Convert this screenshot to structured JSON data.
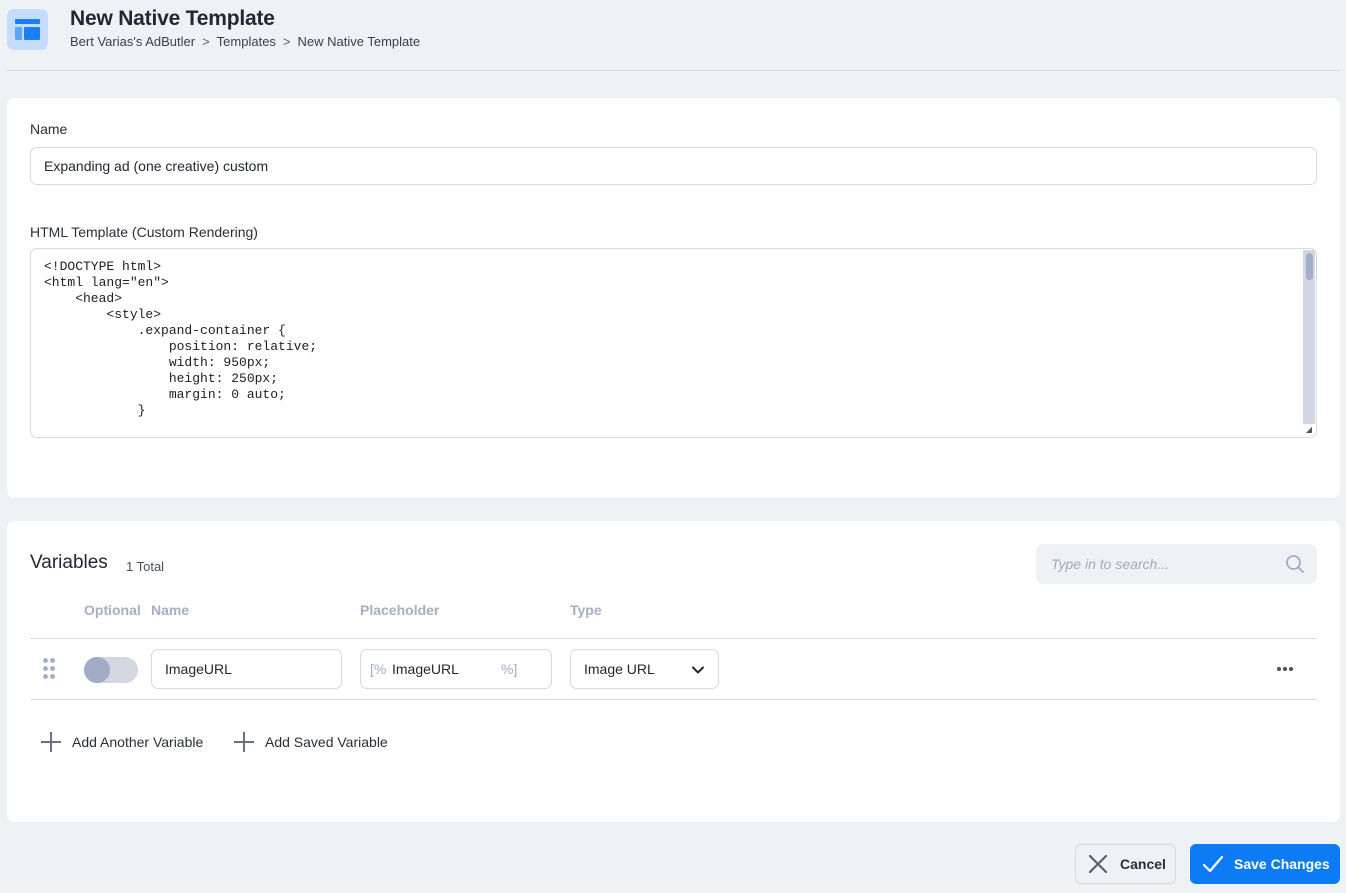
{
  "header": {
    "icon": "template-layout-icon",
    "title": "New Native Template",
    "breadcrumb": [
      "Bert Varias's AdButler",
      "Templates",
      "New Native Template"
    ],
    "breadcrumb_separator": ">"
  },
  "form": {
    "name_label": "Name",
    "name_value": "Expanding ad (one creative) custom",
    "html_label": "HTML Template (Custom Rendering)",
    "html_value": "<!DOCTYPE html>\n<html lang=\"en\">\n    <head>\n        <style>\n            .expand-container {\n                position: relative;\n                width: 950px;\n                height: 250px;\n                margin: 0 auto;\n            }\n"
  },
  "variables": {
    "title": "Variables",
    "count_label": "1 Total",
    "search_placeholder": "Type in to search...",
    "columns": {
      "optional": "Optional",
      "name": "Name",
      "placeholder": "Placeholder",
      "type": "Type"
    },
    "rows": [
      {
        "optional": false,
        "name": "ImageURL",
        "placeholder_prefix": "[%",
        "placeholder_value": "ImageURL",
        "placeholder_suffix": "%]",
        "type": "Image URL"
      }
    ],
    "add_another_label": "Add Another Variable",
    "add_saved_label": "Add Saved Variable"
  },
  "actions": {
    "cancel_label": "Cancel",
    "save_label": "Save Changes"
  },
  "colors": {
    "accent": "#0d7bf5",
    "background": "#eff2f5",
    "header_muted": "#a6aec4"
  }
}
